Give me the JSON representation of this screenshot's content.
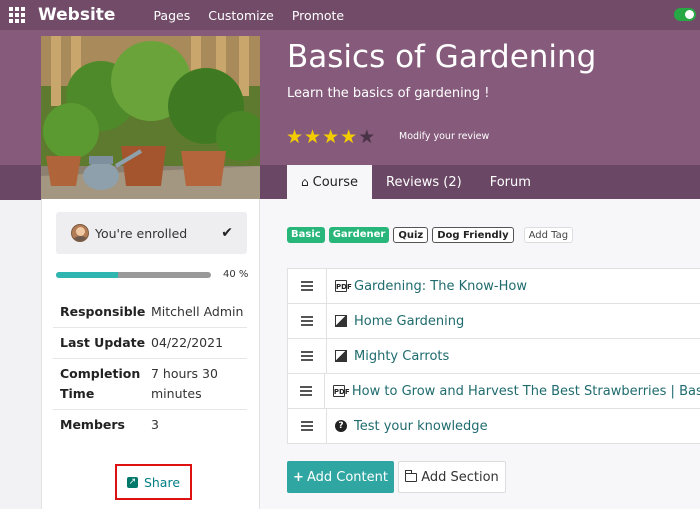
{
  "navbar": {
    "brand": "Website",
    "menu": [
      "Pages",
      "Customize",
      "Promote"
    ]
  },
  "course": {
    "title": "Basics of Gardening",
    "subtitle": "Learn the basics of gardening !",
    "rating": 4,
    "rating_max": 5,
    "modify_review": "Modify your review",
    "tabs": [
      {
        "label": "Course",
        "active": true
      },
      {
        "label": "Reviews (2)",
        "active": false
      },
      {
        "label": "Forum",
        "active": false
      }
    ]
  },
  "sidebar": {
    "enrolled_label": "You're enrolled",
    "progress_percent": 40,
    "progress_label": "40 %",
    "info": [
      {
        "key": "Responsible",
        "value": "Mitchell Admin"
      },
      {
        "key": "Last Update",
        "value": "04/22/2021"
      },
      {
        "key": "Completion Time",
        "value": "7 hours 30 minutes"
      },
      {
        "key": "Members",
        "value": "3"
      }
    ],
    "share_label": "Share"
  },
  "tags": [
    {
      "label": "Basic",
      "style": "green"
    },
    {
      "label": "Gardener",
      "style": "green"
    },
    {
      "label": "Quiz",
      "style": "outline"
    },
    {
      "label": "Dog Friendly",
      "style": "outline"
    }
  ],
  "add_tag_label": "Add Tag",
  "contents": [
    {
      "label": "Gardening: The Know-How",
      "icon": "pdf-icon"
    },
    {
      "label": "Home Gardening",
      "icon": "image-icon"
    },
    {
      "label": "Mighty Carrots",
      "icon": "image-icon"
    },
    {
      "label": "How to Grow and Harvest The Best Strawberries | Basics",
      "icon": "pdf-icon"
    },
    {
      "label": "Test your knowledge",
      "icon": "question-icon"
    }
  ],
  "buttons": {
    "add_content": "Add Content",
    "add_section": "Add Section"
  },
  "colors": {
    "navbar": "#714b67",
    "hero": "#855a7b",
    "accent": "#2fa6a2",
    "star": "#f3cc00"
  }
}
